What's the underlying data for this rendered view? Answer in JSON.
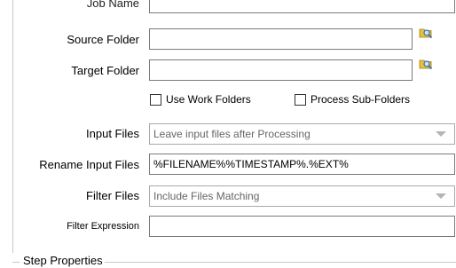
{
  "form": {
    "job_name_label": "Job Name",
    "source_folder_label": "Source Folder",
    "source_folder_value": "",
    "target_folder_label": "Target Folder",
    "target_folder_value": "",
    "use_work_folders_label": "Use Work Folders",
    "use_work_folders_checked": false,
    "process_subfolders_label": "Process Sub-Folders",
    "process_subfolders_checked": false,
    "input_files_label": "Input Files",
    "input_files_value": "Leave input files after Processing",
    "rename_input_files_label": "Rename Input Files",
    "rename_input_files_value": "%FILENAME%%TIMESTAMP%.%EXT%",
    "filter_files_label": "Filter Files",
    "filter_files_value": "Include Files Matching",
    "filter_expression_label": "Filter Expression",
    "filter_expression_value": ""
  },
  "group": {
    "title": "Step Properties"
  },
  "icons": {
    "browse": "folder-search-icon"
  },
  "colors": {
    "border": "#7a7a7a",
    "disabled_text": "#666666",
    "icon_yellow": "#e8c13a",
    "icon_blue": "#3a6fb0"
  }
}
